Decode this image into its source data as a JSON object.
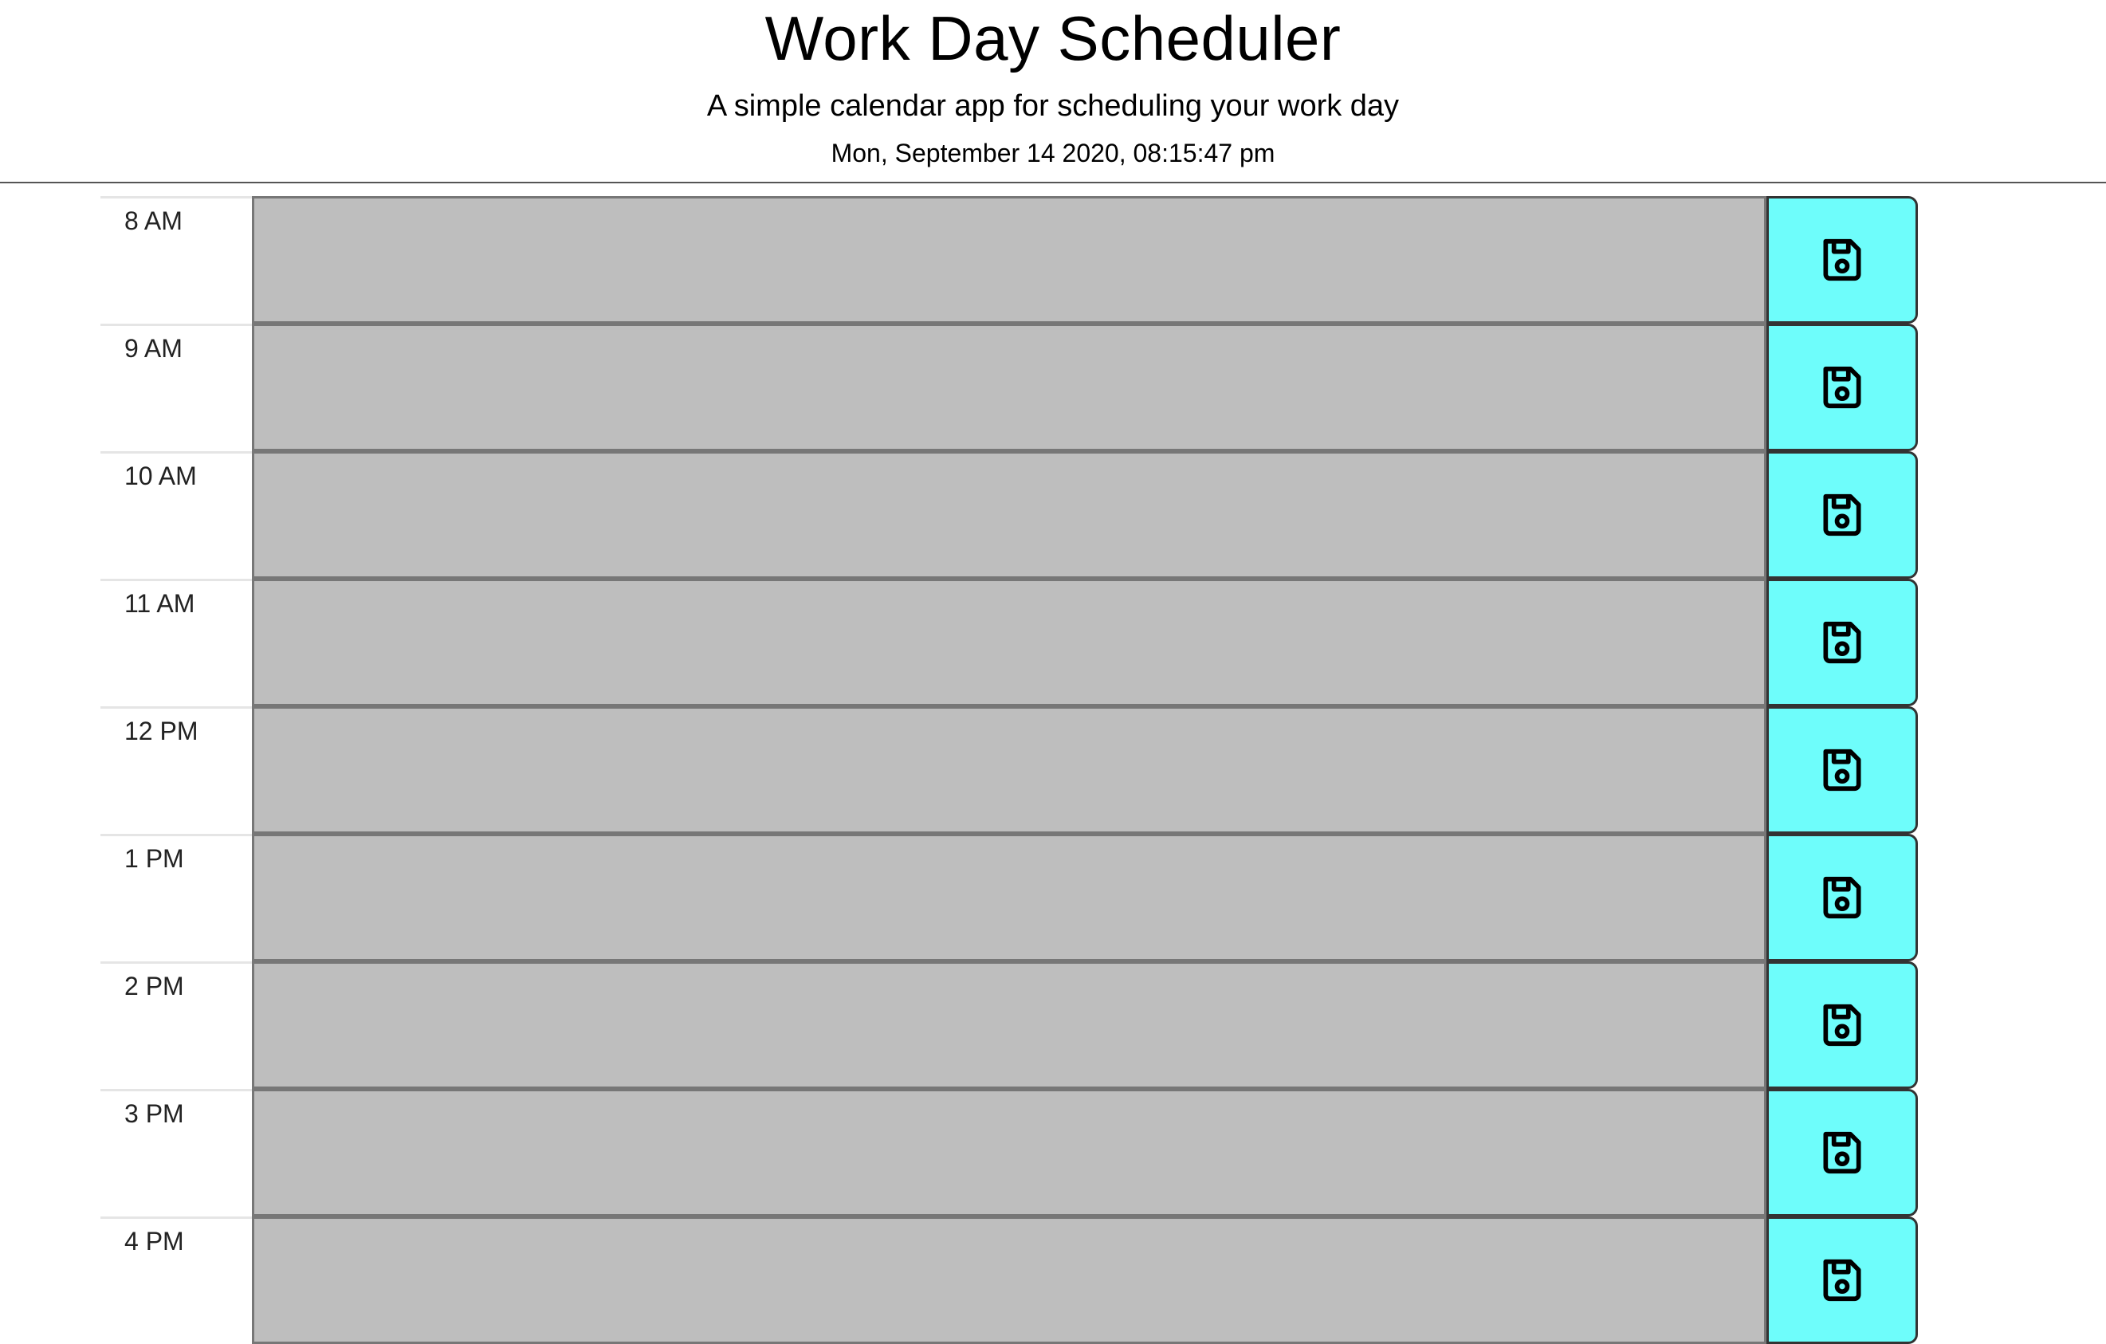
{
  "header": {
    "title": "Work Day Scheduler",
    "subtitle": "A simple calendar app for scheduling your work day",
    "current_datetime": "Mon, September 14 2020, 08:15:47 pm"
  },
  "colors": {
    "past": "#bebebe",
    "save_button": "#6efdfb"
  },
  "save_icon": "save-icon",
  "time_blocks": [
    {
      "hour": "8 AM",
      "text": ""
    },
    {
      "hour": "9 AM",
      "text": ""
    },
    {
      "hour": "10 AM",
      "text": ""
    },
    {
      "hour": "11 AM",
      "text": ""
    },
    {
      "hour": "12 PM",
      "text": ""
    },
    {
      "hour": "1 PM",
      "text": ""
    },
    {
      "hour": "2 PM",
      "text": ""
    },
    {
      "hour": "3 PM",
      "text": ""
    },
    {
      "hour": "4 PM",
      "text": ""
    }
  ]
}
